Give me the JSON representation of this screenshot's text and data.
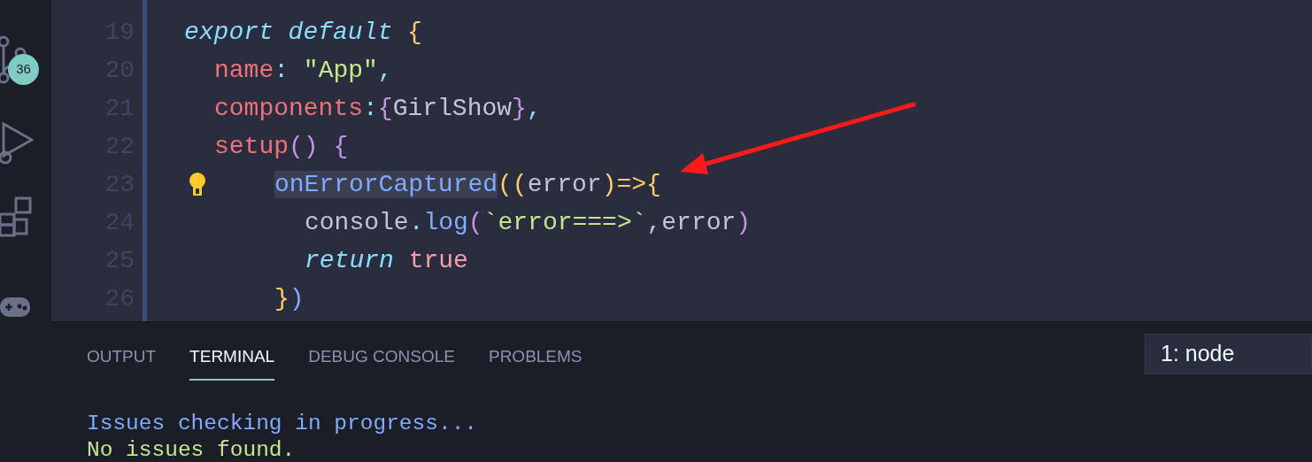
{
  "activity_bar": {
    "badge": "36"
  },
  "editor": {
    "lines": [
      {
        "number": "19",
        "tokens": [
          {
            "text": "export default ",
            "kind": "keyword"
          },
          {
            "text": "{",
            "kind": "brace1"
          }
        ],
        "children": [
          {
            "number": "20",
            "tokens": [
              {
                "text": "name",
                "kind": "property"
              },
              {
                "text": ": ",
                "kind": "punct"
              },
              {
                "text": "\"App\"",
                "kind": "string"
              },
              {
                "text": ",",
                "kind": "punct"
              }
            ]
          },
          {
            "number": "21",
            "tokens": [
              {
                "text": "components",
                "kind": "property"
              },
              {
                "text": ":",
                "kind": "punct"
              },
              {
                "text": "{",
                "kind": "brace2"
              },
              {
                "text": "GirlShow",
                "kind": "plain"
              },
              {
                "text": "}",
                "kind": "brace2"
              },
              {
                "text": ",",
                "kind": "punct"
              }
            ]
          },
          {
            "number": "22",
            "tokens": [
              {
                "text": "setup",
                "kind": "property"
              },
              {
                "text": "() {",
                "kind": "brace2"
              }
            ],
            "children": [
              {
                "number": "23",
                "lightbulb": true,
                "tokens": [
                  {
                    "text": "onErrorCaptured",
                    "kind": "function",
                    "highlighted": true
                  },
                  {
                    "text": "((",
                    "kind": "brace1"
                  },
                  {
                    "text": "error",
                    "kind": "plain"
                  },
                  {
                    "text": ")=>",
                    "kind": "brace1"
                  },
                  {
                    "text": "{",
                    "kind": "brace1"
                  }
                ],
                "children": [
                  {
                    "number": "24",
                    "tokens": [
                      {
                        "text": "console",
                        "kind": "plain"
                      },
                      {
                        "text": ".",
                        "kind": "punct"
                      },
                      {
                        "text": "log",
                        "kind": "function"
                      },
                      {
                        "text": "(",
                        "kind": "brace2"
                      },
                      {
                        "text": "`error===>`",
                        "kind": "string"
                      },
                      {
                        "text": ",error",
                        "kind": "plain"
                      },
                      {
                        "text": ")",
                        "kind": "brace2"
                      }
                    ]
                  },
                  {
                    "number": "25",
                    "tokens": [
                      {
                        "text": "return ",
                        "kind": "keyword"
                      },
                      {
                        "text": "true",
                        "kind": "literal"
                      }
                    ]
                  }
                ]
              },
              {
                "number": "26",
                "tokens": [
                  {
                    "text": "}",
                    "kind": "brace1"
                  },
                  {
                    "text": ")",
                    "kind": "function"
                  }
                ]
              }
            ]
          }
        ]
      }
    ]
  },
  "panel": {
    "tabs": [
      {
        "label": "OUTPUT",
        "selected": false
      },
      {
        "label": "TERMINAL",
        "selected": true
      },
      {
        "label": "DEBUG CONSOLE",
        "selected": false
      },
      {
        "label": "PROBLEMS",
        "selected": false
      }
    ],
    "terminal_select": "1: node",
    "output": [
      {
        "text": "Issues checking in progress...",
        "kind": "info"
      },
      {
        "text": "No issues found.",
        "kind": "success"
      }
    ]
  }
}
